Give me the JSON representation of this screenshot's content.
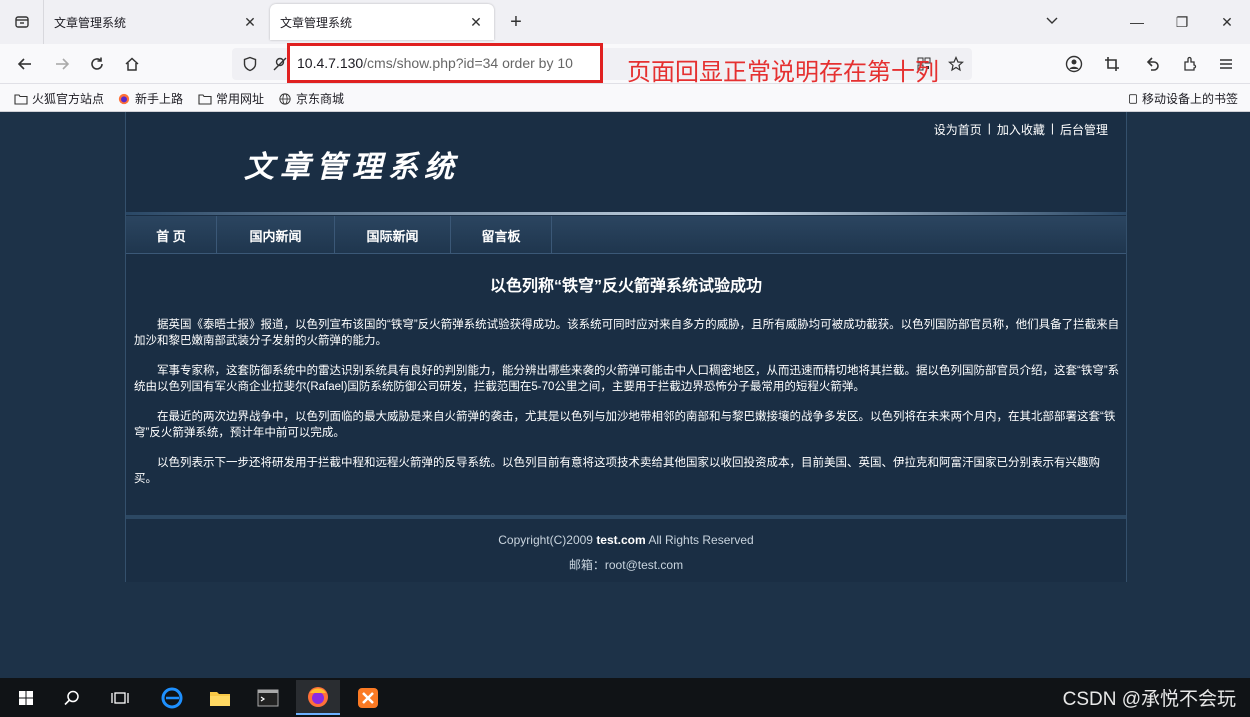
{
  "browser": {
    "tabs": [
      {
        "label": "文章管理系统",
        "close": "✕"
      },
      {
        "label": "文章管理系统",
        "close": "✕"
      }
    ],
    "new_tab": "+",
    "window_controls": {
      "minimize": "—",
      "restore": "❐",
      "close": "✕"
    },
    "url": {
      "host": "10.4.7.130",
      "path": "/cms/show.php?id=34 order by 10"
    },
    "bookmarks": [
      "火狐官方站点",
      "新手上路",
      "常用网址",
      "京东商城"
    ],
    "mobile_bookmarks": "移动设备上的书签"
  },
  "annotation": "页面回显正常说明存在第十列",
  "site": {
    "top_links": [
      "设为首页",
      "|",
      "加入收藏",
      "|",
      "后台管理"
    ],
    "title": "文章管理系统",
    "menu": [
      "首 页",
      "国内新闻",
      "国际新闻",
      "留言板"
    ],
    "article": {
      "title": "以色列称“铁穹”反火箭弹系统试验成功",
      "paragraphs": [
        "据英国《泰晤士报》报道，以色列宣布该国的“铁穹”反火箭弹系统试验获得成功。该系统可同时应对来自多方的威胁，且所有威胁均可被成功截获。以色列国防部官员称，他们具备了拦截来自加沙和黎巴嫩南部武装分子发射的火箭弹的能力。",
        "军事专家称，这套防御系统中的雷达识别系统具有良好的判别能力，能分辨出哪些来袭的火箭弹可能击中人口稠密地区，从而迅速而精切地将其拦截。据以色列国防部官员介绍，这套“铁穹”系统由以色列国有军火商企业拉斐尔(Rafael)国防系统防御公司研发，拦截范围在5-70公里之间，主要用于拦截边界恐怖分子最常用的短程火箭弹。",
        "在最近的两次边界战争中，以色列面临的最大威胁是来自火箭弹的袭击，尤其是以色列与加沙地带相邻的南部和与黎巴嫩接壤的战争多发区。以色列将在未来两个月内，在其北部部署这套“铁穹”反火箭弹系统，预计年中前可以完成。",
        "以色列表示下一步还将研发用于拦截中程和远程火箭弹的反导系统。以色列目前有意将这项技术卖给其他国家以收回投资成本，目前美国、英国、伊拉克和阿富汗国家已分别表示有兴趣购买。"
      ]
    },
    "footer": {
      "copyright_prefix": "Copyright(C)2009 ",
      "copyright_site": "test.com",
      "copyright_suffix": " All Rights Reserved",
      "email": "邮箱：root@test.com"
    }
  },
  "taskbar": {
    "icons": [
      "windows-start-icon",
      "search-icon",
      "task-view-icon",
      "edge-icon",
      "file-explorer-icon",
      "terminal-icon",
      "firefox-icon",
      "xampp-icon"
    ],
    "watermark": "CSDN @承悦不会玩"
  }
}
